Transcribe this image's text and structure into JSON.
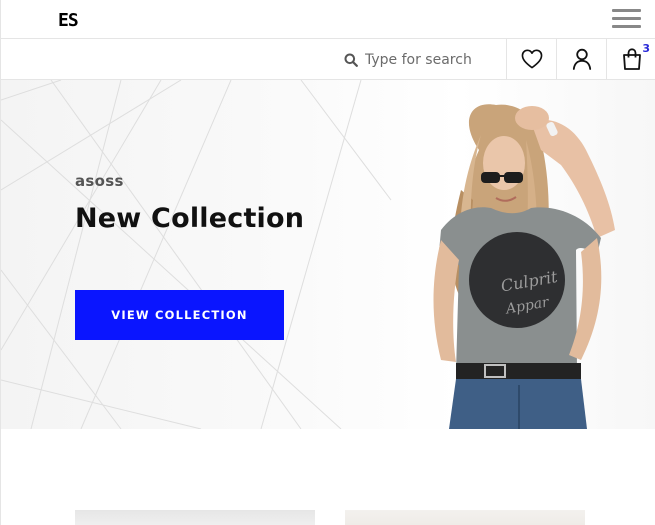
{
  "header": {
    "logo": "ES",
    "menu_icon": "hamburger-icon"
  },
  "toolbar": {
    "search_placeholder": "Type for search",
    "search_icon": "search-icon",
    "wishlist_icon": "heart-icon",
    "account_icon": "user-icon",
    "cart_icon": "shopping-bag-icon",
    "cart_count": "3"
  },
  "hero": {
    "brand": "asoss",
    "title": "New Collection",
    "button_label": "VIEW COLLECTION",
    "button_color": "#0a15ff",
    "image": "woman-in-grey-tshirt-photo"
  },
  "colors": {
    "accent": "#0a15ff",
    "cart_badge": "#2a2ad8",
    "border": "#e5e5e5"
  }
}
